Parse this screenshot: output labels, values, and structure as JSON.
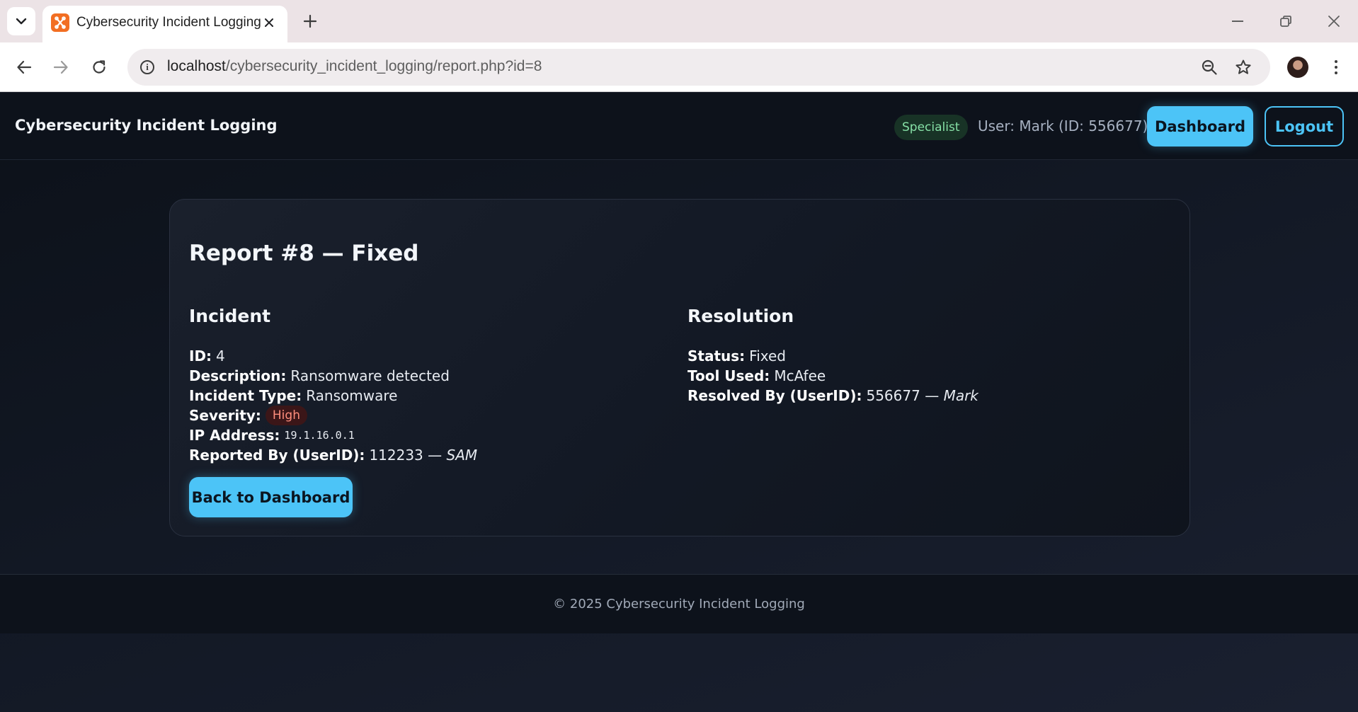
{
  "browser": {
    "tab_title": "Cybersecurity Incident Logging",
    "url_host": "localhost",
    "url_path": "/cybersecurity_incident_logging/report.php?id=8"
  },
  "header": {
    "brand": "Cybersecurity Incident Logging",
    "role": "Specialist",
    "user": "User: Mark (ID: 556677)",
    "dashboard_label": "Dashboard",
    "logout_label": "Logout"
  },
  "report": {
    "title": "Report #8 — Fixed",
    "incident": {
      "heading": "Incident",
      "id_label": "ID:",
      "id": "4",
      "description_label": "Description:",
      "description": "Ransomware detected",
      "type_label": "Incident Type:",
      "type": "Ransomware",
      "severity_label": "Severity:",
      "severity": "High",
      "ip_label": "IP Address:",
      "ip": "19.1.16.0.1",
      "reported_by_label": "Reported By (UserID):",
      "reported_by_id": "112233 —",
      "reported_by_name": "SAM"
    },
    "resolution": {
      "heading": "Resolution",
      "status_label": "Status:",
      "status": "Fixed",
      "tool_label": "Tool Used:",
      "tool": "McAfee",
      "resolved_by_label": "Resolved By (UserID):",
      "resolved_by_id": "556677 —",
      "resolved_by_name": "Mark"
    },
    "back_label": "Back to Dashboard"
  },
  "footer": {
    "text": "© 2025 Cybersecurity Incident Logging"
  },
  "colors": {
    "accent": "#4cc4f7",
    "role_badge_text": "#86e0a6",
    "severity_high": "#ff8e7d"
  },
  "icons": [
    "tab-list-icon",
    "favicon-icon",
    "close-icon",
    "plus-icon",
    "minimize-icon",
    "restore-icon",
    "back-arrow-icon",
    "forward-arrow-icon",
    "reload-icon",
    "info-icon",
    "zoom-icon",
    "star-icon",
    "profile-avatar",
    "more-menu-icon"
  ]
}
